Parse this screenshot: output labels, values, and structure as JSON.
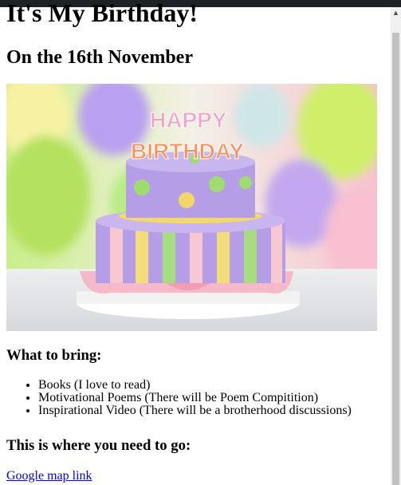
{
  "page": {
    "title": "It's My Birthday!",
    "subtitle": "On the 16th November",
    "bring_heading": "What to bring:",
    "bring_items": [
      "Books (I love to read)",
      "Motivational Poems (There will be Poem Compitition)",
      "Inspirational Video (There will be a brotherhood discussions)"
    ],
    "go_heading": "This is where you need to go:",
    "map_link": "Google map link"
  },
  "image": {
    "subject": "birthday-cake",
    "candle_text": "HAPPY BIRTHDAY"
  },
  "colors": {
    "link": "#0000ee",
    "scrollbar_thumb": "#c1c1c1",
    "scrollbar_track": "#f1f1f1"
  }
}
